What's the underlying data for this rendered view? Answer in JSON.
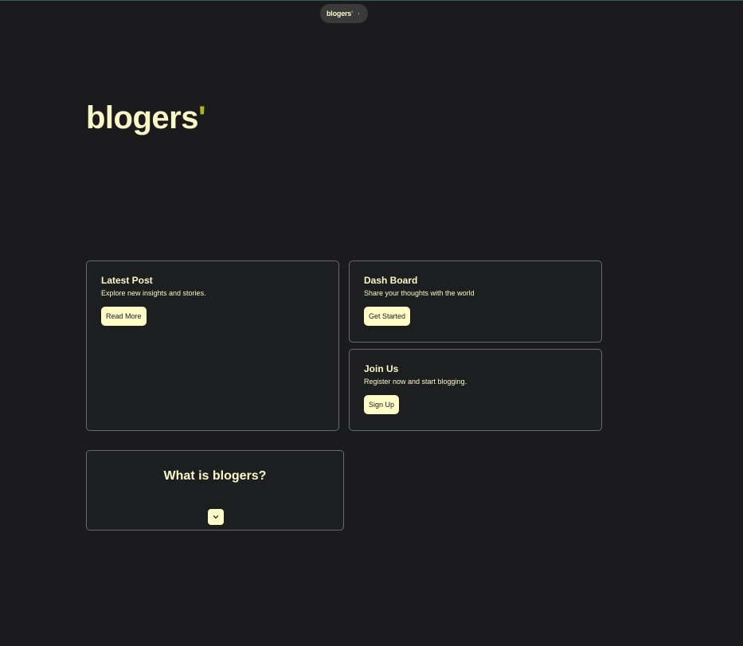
{
  "nav": {
    "brand": "blogers",
    "brand_mark": "'",
    "chevron_icon": "chevron-right-icon"
  },
  "hero": {
    "title": "blogers",
    "title_mark": "'"
  },
  "cards": {
    "latest": {
      "title": "Latest Post",
      "description": "Explore new insights and stories.",
      "button_label": "Read More"
    },
    "dashboard": {
      "title": "Dash Board",
      "description": "Share your thoughts with the world",
      "button_label": "Get Started"
    },
    "join": {
      "title": "Join Us",
      "description": "Register now and start blogging.",
      "button_label": "Sign Up"
    },
    "what": {
      "title": "What is blogers?",
      "expand_icon": "chevron-down-icon"
    }
  },
  "colors": {
    "background": "#1b1b1d",
    "text": "#fbf8c8",
    "accent": "#b5b51a",
    "button_bg": "#fffcc8",
    "card_border": "#6a6a6a"
  }
}
